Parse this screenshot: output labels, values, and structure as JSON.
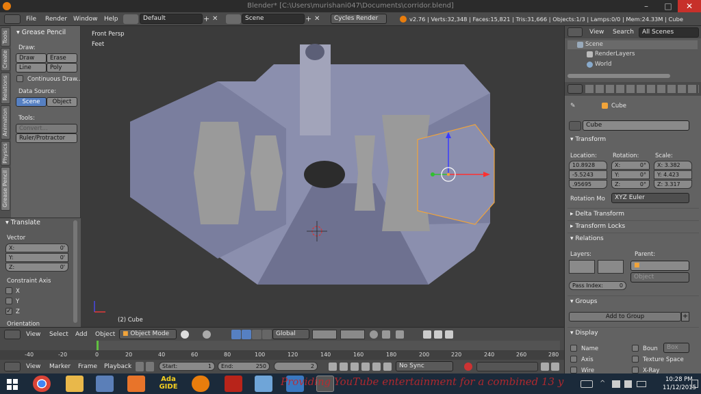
{
  "title": "Blender* [C:\\Users\\murishani047\\Documents\\corridor.blend]",
  "window_controls": {
    "minimize": "–",
    "maximize": "□",
    "close": "✕"
  },
  "topbar": {
    "menus": [
      "File",
      "Render",
      "Window",
      "Help"
    ],
    "layout": "Default",
    "scene": "Scene",
    "engine": "Cycles Render",
    "stats": "v2.76 | Verts:32,348 | Faces:15,821 | Tris:31,666 | Objects:1/3 | Lamps:0/0 | Mem:24.33M | Cube"
  },
  "toolshelf": {
    "tabs": [
      "Tools",
      "Create",
      "Relations",
      "Animation",
      "Physics",
      "Grease Pencil"
    ],
    "panel_title": "Grease Pencil",
    "draw_label": "Draw:",
    "draw_buttons": [
      "Draw",
      "Erase",
      "Line",
      "Poly"
    ],
    "continuous": "Continuous Draw...",
    "data_source_label": "Data Source:",
    "data_source": [
      "Scene",
      "Object"
    ],
    "tools_label": "Tools:",
    "convert": "Convert...",
    "ruler": "Ruler/Protractor"
  },
  "operator_panel": {
    "title": "Translate",
    "vector_label": "Vector",
    "vector": [
      {
        "axis": "X:",
        "value": "0'"
      },
      {
        "axis": "Y:",
        "value": "0'"
      },
      {
        "axis": "Z:",
        "value": "0'"
      }
    ],
    "constraint_label": "Constraint Axis",
    "constraints": [
      {
        "axis": "X",
        "checked": false
      },
      {
        "axis": "Y",
        "checked": false
      },
      {
        "axis": "Z",
        "checked": true
      }
    ],
    "orientation_label": "Orientation"
  },
  "viewport": {
    "view_name": "Front Persp",
    "units": "Feet",
    "object_label": "(2) Cube"
  },
  "vp_header": {
    "menus": [
      "View",
      "Select",
      "Add",
      "Object"
    ],
    "mode": "Object Mode",
    "orientation": "Global"
  },
  "timeline": {
    "ticks": [
      "-40",
      "-20",
      "0",
      "20",
      "40",
      "60",
      "80",
      "100",
      "120",
      "140",
      "160",
      "180",
      "200",
      "220",
      "240",
      "260",
      "280"
    ],
    "menus": [
      "View",
      "Marker",
      "Frame",
      "Playback"
    ],
    "start_label": "Start:",
    "start": "1",
    "end_label": "End:",
    "end": "250",
    "current": "2",
    "sync": "No Sync"
  },
  "outliner": {
    "menus": [
      "View",
      "Search"
    ],
    "filter": "All Scenes",
    "items": [
      "Scene",
      "RenderLayers",
      "World"
    ]
  },
  "properties": {
    "breadcrumb": "Cube",
    "object_name": "Cube",
    "transform_title": "Transform",
    "location_label": "Location:",
    "rotation_label": "Rotation:",
    "scale_label": "Scale:",
    "location": [
      "10.8928",
      "-5.5243",
      ".95695"
    ],
    "rotation": [
      {
        "axis": "X:",
        "value": "0°"
      },
      {
        "axis": "Y:",
        "value": "0°"
      },
      {
        "axis": "Z:",
        "value": "0°"
      }
    ],
    "scale": [
      "X: 3.382",
      "Y: 4.423",
      "Z: 3.317"
    ],
    "rotation_mode_label": "Rotation Mo",
    "rotation_mode": "XYZ Euler",
    "delta_title": "Delta Transform",
    "locks_title": "Transform Locks",
    "relations_title": "Relations",
    "layers_label": "Layers:",
    "parent_label": "Parent:",
    "parent_type": "Object",
    "pass_index_label": "Pass Index:",
    "pass_index": "0",
    "groups_title": "Groups",
    "add_to_group": "Add to Group",
    "display_title": "Display",
    "display_opts": [
      "Name",
      "Axis",
      "Wire",
      "Boun",
      "Texture Space",
      "X-Ray"
    ],
    "bounds_type": "Box"
  },
  "taskbar": {
    "overlay": "Providing YouTube entertainment for a combined 13 y",
    "time": "10:28 PM",
    "date": "11/12/2015",
    "ada_label": "Ada GIDE"
  }
}
